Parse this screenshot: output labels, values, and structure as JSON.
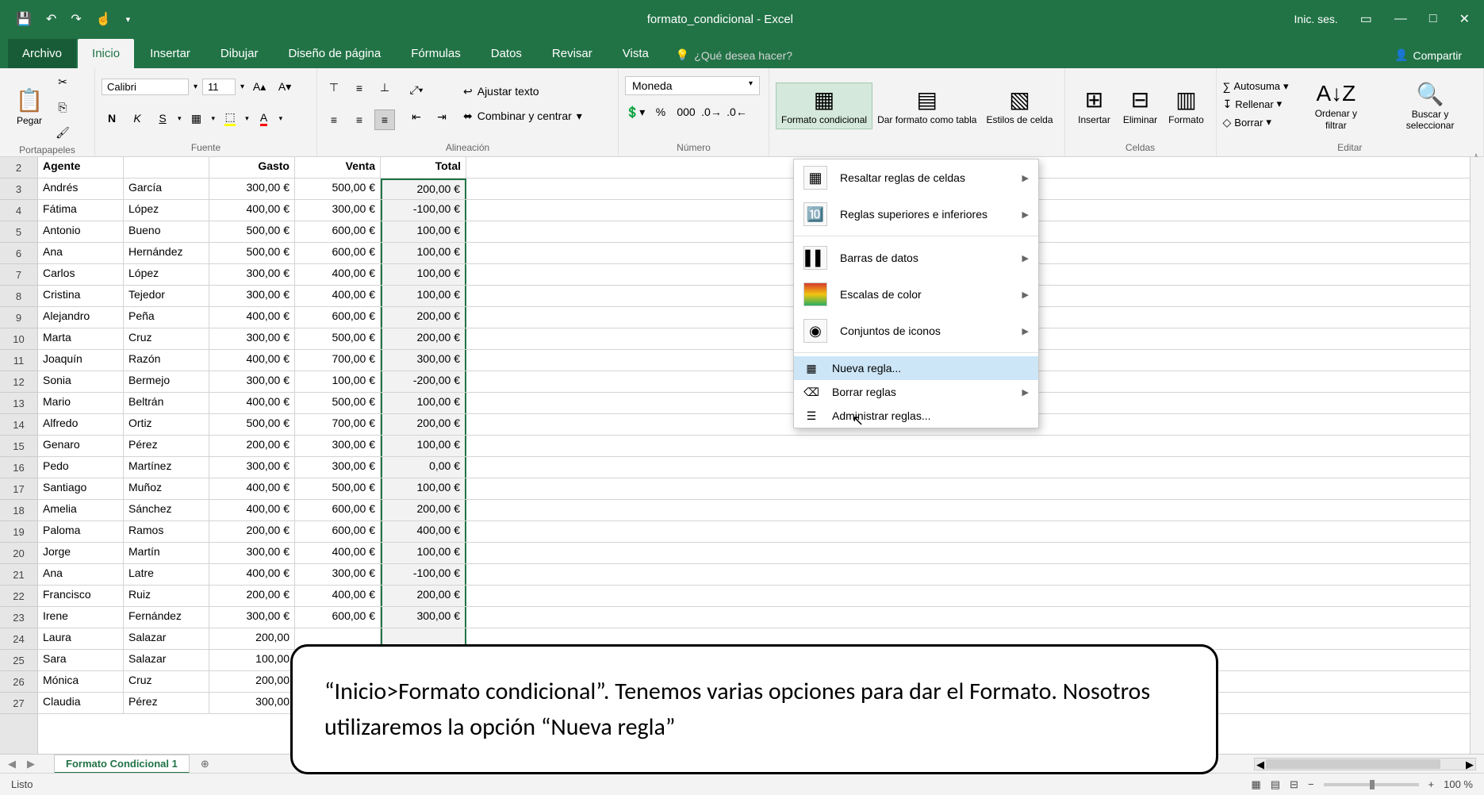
{
  "titlebar": {
    "title": "formato_condicional - Excel",
    "signin": "Inic. ses."
  },
  "tabs": {
    "file": "Archivo",
    "home": "Inicio",
    "insert": "Insertar",
    "draw": "Dibujar",
    "layout": "Diseño de página",
    "formulas": "Fórmulas",
    "data": "Datos",
    "review": "Revisar",
    "view": "Vista",
    "tellme": "¿Qué desea hacer?",
    "share": "Compartir"
  },
  "ribbon": {
    "clipboard": {
      "label": "Portapapeles",
      "paste": "Pegar"
    },
    "font": {
      "label": "Fuente",
      "name": "Calibri",
      "size": "11",
      "bold": "N",
      "italic": "K",
      "underline": "S"
    },
    "alignment": {
      "label": "Alineación",
      "wrap": "Ajustar texto",
      "merge": "Combinar y centrar"
    },
    "number": {
      "label": "Número",
      "format": "Moneda",
      "thousands": "000"
    },
    "styles": {
      "cond": "Formato condicional",
      "table": "Dar formato como tabla",
      "cell": "Estilos de celda"
    },
    "cells": {
      "label": "Celdas",
      "insert": "Insertar",
      "delete": "Eliminar",
      "format": "Formato"
    },
    "editing": {
      "label": "Editar",
      "autosum": "Autosuma",
      "fill": "Rellenar",
      "clear": "Borrar",
      "sort": "Ordenar y filtrar",
      "find": "Buscar y seleccionar"
    }
  },
  "cf_menu": {
    "highlight": "Resaltar reglas de celdas",
    "toprules": "Reglas superiores e inferiores",
    "databars": "Barras de datos",
    "colorscales": "Escalas de color",
    "iconsets": "Conjuntos de iconos",
    "newrule": "Nueva regla...",
    "clear": "Borrar reglas",
    "manage": "Administrar reglas..."
  },
  "grid": {
    "headers": {
      "a": "Agente",
      "b": "",
      "c": "Gasto",
      "d": "Venta",
      "e": "Total"
    },
    "rows": [
      {
        "n": "3",
        "a": "Andrés",
        "b": "García",
        "c": "300,00 €",
        "d": "500,00 €",
        "e": "200,00 €"
      },
      {
        "n": "4",
        "a": "Fátima",
        "b": "López",
        "c": "400,00 €",
        "d": "300,00 €",
        "e": "-100,00 €"
      },
      {
        "n": "5",
        "a": "Antonio",
        "b": "Bueno",
        "c": "500,00 €",
        "d": "600,00 €",
        "e": "100,00 €"
      },
      {
        "n": "6",
        "a": "Ana",
        "b": "Hernández",
        "c": "500,00 €",
        "d": "600,00 €",
        "e": "100,00 €"
      },
      {
        "n": "7",
        "a": "Carlos",
        "b": "López",
        "c": "300,00 €",
        "d": "400,00 €",
        "e": "100,00 €"
      },
      {
        "n": "8",
        "a": "Cristina",
        "b": "Tejedor",
        "c": "300,00 €",
        "d": "400,00 €",
        "e": "100,00 €"
      },
      {
        "n": "9",
        "a": "Alejandro",
        "b": "Peña",
        "c": "400,00 €",
        "d": "600,00 €",
        "e": "200,00 €"
      },
      {
        "n": "10",
        "a": "Marta",
        "b": "Cruz",
        "c": "300,00 €",
        "d": "500,00 €",
        "e": "200,00 €"
      },
      {
        "n": "11",
        "a": "Joaquín",
        "b": "Razón",
        "c": "400,00 €",
        "d": "700,00 €",
        "e": "300,00 €"
      },
      {
        "n": "12",
        "a": "Sonia",
        "b": "Bermejo",
        "c": "300,00 €",
        "d": "100,00 €",
        "e": "-200,00 €"
      },
      {
        "n": "13",
        "a": "Mario",
        "b": "Beltrán",
        "c": "400,00 €",
        "d": "500,00 €",
        "e": "100,00 €"
      },
      {
        "n": "14",
        "a": "Alfredo",
        "b": "Ortiz",
        "c": "500,00 €",
        "d": "700,00 €",
        "e": "200,00 €"
      },
      {
        "n": "15",
        "a": "Genaro",
        "b": "Pérez",
        "c": "200,00 €",
        "d": "300,00 €",
        "e": "100,00 €"
      },
      {
        "n": "16",
        "a": "Pedo",
        "b": "Martínez",
        "c": "300,00 €",
        "d": "300,00 €",
        "e": "0,00 €"
      },
      {
        "n": "17",
        "a": "Santiago",
        "b": "Muñoz",
        "c": "400,00 €",
        "d": "500,00 €",
        "e": "100,00 €"
      },
      {
        "n": "18",
        "a": "Amelia",
        "b": "Sánchez",
        "c": "400,00 €",
        "d": "600,00 €",
        "e": "200,00 €"
      },
      {
        "n": "19",
        "a": "Paloma",
        "b": "Ramos",
        "c": "200,00 €",
        "d": "600,00 €",
        "e": "400,00 €"
      },
      {
        "n": "20",
        "a": "Jorge",
        "b": "Martín",
        "c": "300,00 €",
        "d": "400,00 €",
        "e": "100,00 €"
      },
      {
        "n": "21",
        "a": "Ana",
        "b": "Latre",
        "c": "400,00 €",
        "d": "300,00 €",
        "e": "-100,00 €"
      },
      {
        "n": "22",
        "a": "Francisco",
        "b": "Ruiz",
        "c": "200,00 €",
        "d": "400,00 €",
        "e": "200,00 €"
      },
      {
        "n": "23",
        "a": "Irene",
        "b": "Fernández",
        "c": "300,00 €",
        "d": "600,00 €",
        "e": "300,00 €"
      },
      {
        "n": "24",
        "a": "Laura",
        "b": "Salazar",
        "c": "200,00",
        "d": "",
        "e": ""
      },
      {
        "n": "25",
        "a": "Sara",
        "b": "Salazar",
        "c": "100,00",
        "d": "",
        "e": ""
      },
      {
        "n": "26",
        "a": "Mónica",
        "b": "Cruz",
        "c": "200,00",
        "d": "",
        "e": ""
      },
      {
        "n": "27",
        "a": "Claudia",
        "b": "Pérez",
        "c": "300,00",
        "d": "",
        "e": ""
      }
    ]
  },
  "sheet": {
    "name": "Formato Condicional 1"
  },
  "statusbar": {
    "ready": "Listo",
    "zoom": "100 %"
  },
  "callout": "“Inicio>Formato condicional”. Tenemos varias opciones para dar el Formato. Nosotros utilizaremos la opción “Nueva regla”"
}
